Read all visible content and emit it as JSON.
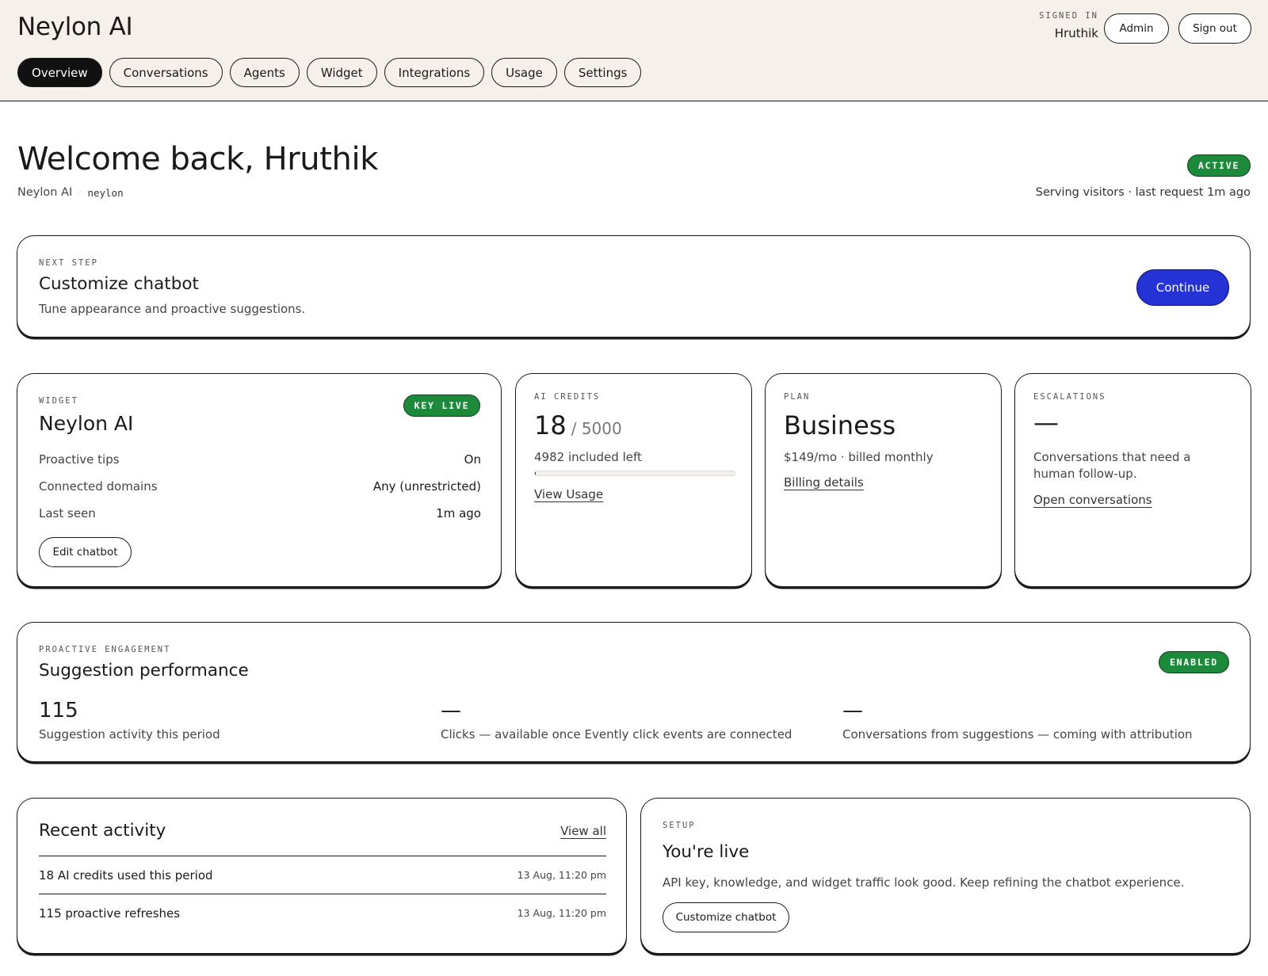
{
  "header": {
    "brand": "Neylon AI",
    "signed_in_label": "SIGNED IN",
    "user": "Hruthik",
    "admin_label": "Admin",
    "signout_label": "Sign out",
    "tabs": [
      "Overview",
      "Conversations",
      "Agents",
      "Widget",
      "Integrations",
      "Usage",
      "Settings"
    ],
    "active_tab": "Overview"
  },
  "welcome": {
    "title": "Welcome back, Hruthik",
    "org": "Neylon AI",
    "slug": "neylon",
    "status": "ACTIVE",
    "serving": "Serving visitors · last request 1m ago"
  },
  "next_step": {
    "eyebrow": "NEXT STEP",
    "title": "Customize chatbot",
    "desc": "Tune appearance and proactive suggestions.",
    "button": "Continue"
  },
  "widget": {
    "eyebrow": "WIDGET",
    "title": "Neylon AI",
    "badge": "KEY LIVE",
    "rows": [
      {
        "k": "Proactive tips",
        "v": "On"
      },
      {
        "k": "Connected domains",
        "v": "Any (unrestricted)"
      },
      {
        "k": "Last seen",
        "v": "1m ago"
      }
    ],
    "button": "Edit chatbot"
  },
  "credits": {
    "eyebrow": "AI CREDITS",
    "used": "18",
    "total": "/ 5000",
    "left": "4982 included left",
    "progress": 0.0036,
    "link": "View Usage"
  },
  "plan": {
    "eyebrow": "PLAN",
    "name": "Business",
    "price": "$149/mo · billed monthly",
    "link": "Billing details"
  },
  "escalations": {
    "eyebrow": "ESCALATIONS",
    "value": "—",
    "desc": "Conversations that need a human follow-up.",
    "link": "Open conversations"
  },
  "proactive": {
    "eyebrow": "PROACTIVE ENGAGEMENT",
    "title": "Suggestion performance",
    "badge": "ENABLED",
    "stats": [
      {
        "value": "115",
        "label": "Suggestion activity this period"
      },
      {
        "value": "—",
        "label": "Clicks — available once Evently click events are connected"
      },
      {
        "value": "—",
        "label": "Conversations from suggestions — coming with attribution"
      }
    ]
  },
  "activity": {
    "title": "Recent activity",
    "view_all": "View all",
    "items": [
      {
        "text": "18 AI credits used this period",
        "when": "13 Aug, 11:20 pm"
      },
      {
        "text": "115 proactive refreshes",
        "when": "13 Aug, 11:20 pm"
      }
    ]
  },
  "setup": {
    "eyebrow": "SETUP",
    "title": "You're live",
    "desc": "API key, knowledge, and widget traffic look good. Keep refining the chatbot experience.",
    "button": "Customize chatbot"
  },
  "colors": {
    "header_bg": "#f6f0ea",
    "badge_green": "#1c8a3a",
    "primary_blue": "#2432d6"
  }
}
